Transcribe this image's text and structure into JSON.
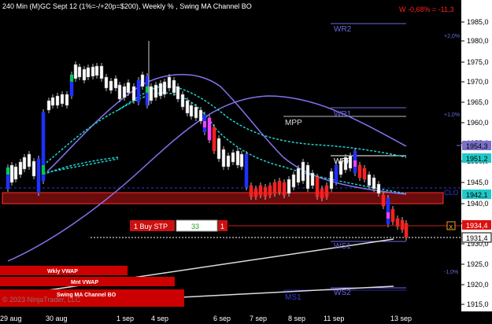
{
  "title": "240 Min (M)GC Sept 12 (1%=-/+20p=$200), Weekly % , Swing MA Channel BO",
  "weekly_change": "W -0,68% = -11,3",
  "colors": {
    "background": "#000000",
    "price_axis_bg": "#ffffff",
    "candle_up": "#ffffff",
    "candle_down": "#ff2020",
    "bar_blue": "#2030ff",
    "bar_green": "#00cc44",
    "bar_magenta": "#ff40ff",
    "ma_channel": "#20d0d0",
    "swing_ma": "#8870f0",
    "zone_fill": "#7a1010",
    "zone_border": "#ff3030",
    "vwap_bar": "#cc0000"
  },
  "levels": {
    "wr2": "WR2",
    "wr1": "WR1",
    "mpp": "MPP",
    "wpp": "WPP",
    "ws1": "WS1",
    "ws2": "WS2",
    "ms1": "MS1",
    "clo": "CLO"
  },
  "pct_labels": {
    "plus2": "+2,0%",
    "plus1": "+1,0%",
    "minus1": "-1,0%"
  },
  "price_axis": {
    "ticks": [
      "1985,0",
      "1980,0",
      "1975,0",
      "1970,0",
      "1965,0",
      "1960,0",
      "1955,0",
      "1950,0",
      "1945,0",
      "1940,0",
      "1935,0",
      "1930,0",
      "1925,0",
      "1920,0",
      "1915,0"
    ],
    "badges": {
      "b1954": "1954,3",
      "b1951": "1951,2",
      "b1942": "1942,1",
      "b1934": "1934,4",
      "b1931": "1931,4"
    }
  },
  "order": {
    "label": "1 Buy STP",
    "qty": "33",
    "count": "1",
    "close": "x"
  },
  "vwap": {
    "weekly": "Wkly VWAP",
    "monthly": "Mnt VWAP",
    "swing": "Swing MA Channel BO"
  },
  "copyright": "© 2023 NinjaTrader, LLC",
  "x_axis": [
    "29 aug",
    "30 aug",
    "1 sep",
    "4 sep",
    "6 sep",
    "7 sep",
    "8 sep",
    "11 sep",
    "13 sep"
  ]
}
